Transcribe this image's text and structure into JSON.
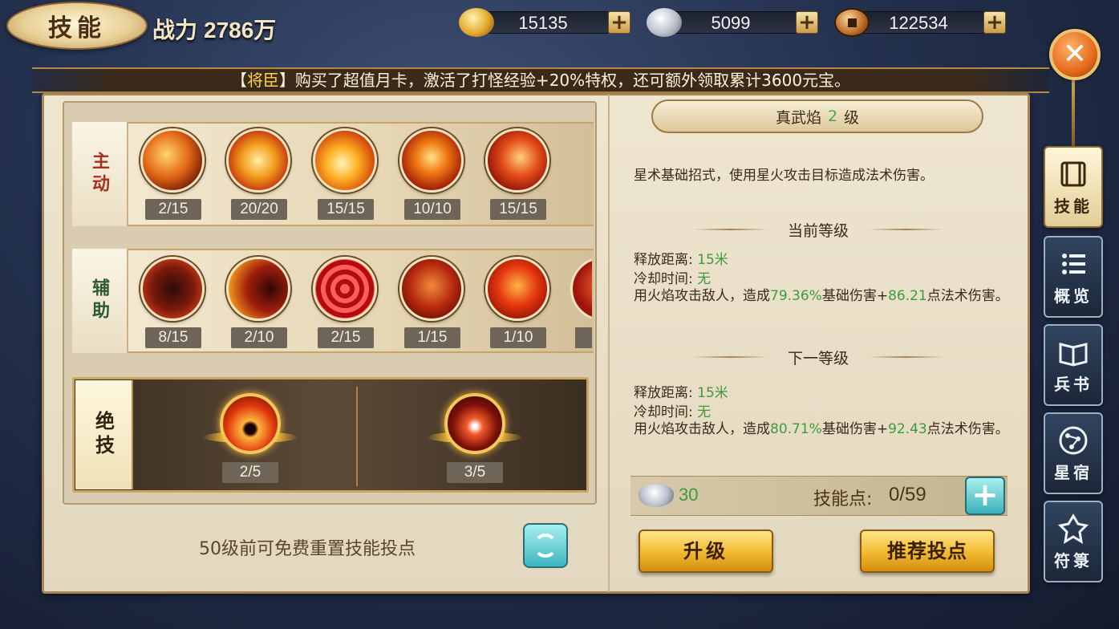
{
  "header": {
    "title": "技能",
    "power_label": "战力",
    "power_value": "2786万"
  },
  "resources": {
    "gold": "15135",
    "silver": "5099",
    "copper": "122534",
    "plus": "+"
  },
  "close_label": "✕",
  "marquee": {
    "prefix": "【",
    "name": "将臣",
    "suffix": "】购买了超值月卡，激活了打怪经验+20%特权，还可额外领取累计3600元宝。"
  },
  "active_row": {
    "label": "主动",
    "skills": [
      {
        "level": "2/15"
      },
      {
        "level": "20/20"
      },
      {
        "level": "15/15"
      },
      {
        "level": "10/10"
      },
      {
        "level": "15/15"
      }
    ]
  },
  "support_row": {
    "label": "辅助",
    "skills": [
      {
        "level": "8/15"
      },
      {
        "level": "2/10"
      },
      {
        "level": "2/15"
      },
      {
        "level": "1/15"
      },
      {
        "level": "1/10"
      }
    ]
  },
  "ultimate_row": {
    "label": "绝技",
    "skills": [
      {
        "level": "2/5"
      },
      {
        "level": "3/5"
      }
    ]
  },
  "reset": {
    "text": "50级前可免费重置技能投点"
  },
  "detail": {
    "skill_name": "真武焰",
    "skill_level": "2",
    "level_unit": "级",
    "description": "星术基础招式，使用星火攻击目标造成法术伤害。",
    "current": {
      "heading": "当前等级",
      "range_label": "释放距离: ",
      "range_value": "15米",
      "cd_label": "冷却时间: ",
      "cd_value": "无",
      "effect_a": "用火焰攻击敌人，造成",
      "effect_pct": "79.36%",
      "effect_b": "基础伤害+",
      "effect_flat": "86.21",
      "effect_c": "点法术伤害。"
    },
    "next": {
      "heading": "下一等级",
      "range_label": "释放距离: ",
      "range_value": "15米",
      "cd_label": "冷却时间: ",
      "cd_value": "无",
      "effect_a": "用火焰攻击敌人，造成",
      "effect_pct": "80.71%",
      "effect_b": "基础伤害+",
      "effect_flat": "92.43",
      "effect_c": "点法术伤害。"
    },
    "cost_value": "30",
    "skill_points_label": "技能点:",
    "skill_points_value": "0/59",
    "plus": "+",
    "upgrade_label": "升级",
    "recommend_label": "推荐投点"
  },
  "side_menu": [
    {
      "label": "技能",
      "icon": "scroll-icon",
      "active": true
    },
    {
      "label": "概览",
      "icon": "list-icon"
    },
    {
      "label": "兵书",
      "icon": "book-icon"
    },
    {
      "label": "星宿",
      "icon": "constellation-icon"
    },
    {
      "label": "符箓",
      "icon": "talisman-icon"
    }
  ],
  "colors": {
    "accent_gold": "#f1b92d",
    "teal_button": "#3fb6bf",
    "green_value": "#3f9a3f"
  }
}
